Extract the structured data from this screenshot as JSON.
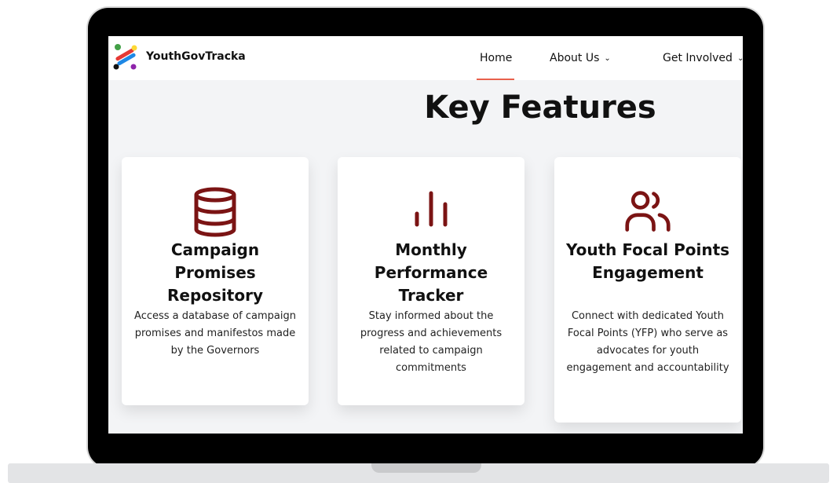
{
  "brand": {
    "name": "YouthGovTracka"
  },
  "nav": {
    "items": [
      {
        "label": "Home",
        "active": true
      },
      {
        "label": "About Us"
      },
      {
        "label": "Get Involved"
      }
    ]
  },
  "section": {
    "title": "Key Features"
  },
  "cards": [
    {
      "icon": "database-icon",
      "title": "Campaign Promises Repository",
      "description": "Access a database of campaign promises and manifestos made by the Governors"
    },
    {
      "icon": "bar-chart-icon",
      "title": "Monthly Performance Tracker",
      "description": "Stay informed about the progress and achievements related to campaign commitments"
    },
    {
      "icon": "users-icon",
      "title": "Youth Focal Points Engagement",
      "description": "Connect with dedicated Youth Focal Points (YFP) who serve as advocates for youth engagement and accountability"
    }
  ],
  "colors": {
    "accent": "#7b1414",
    "nav_underline": "#e8604c",
    "device_frame": "#000000"
  }
}
